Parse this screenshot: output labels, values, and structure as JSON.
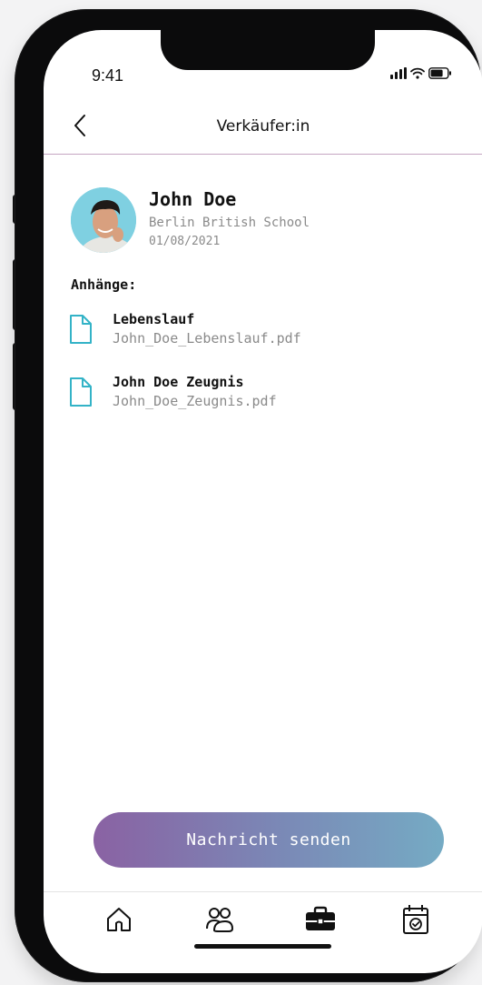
{
  "status_bar": {
    "time": "9:41"
  },
  "header": {
    "title": "Verkäufer:in",
    "back_icon": "chevron-left-icon"
  },
  "profile": {
    "name": "John Doe",
    "school": "Berlin British School",
    "date": "01/08/2021"
  },
  "attachments": {
    "heading": "Anhänge:",
    "items": [
      {
        "title": "Lebenslauf",
        "file": "John_Doe_Lebenslauf.pdf",
        "icon": "file-icon"
      },
      {
        "title": "John Doe Zeugnis",
        "file": "John_Doe_Zeugnis.pdf",
        "icon": "file-icon"
      }
    ]
  },
  "actions": {
    "send_label": "Nachricht senden"
  },
  "tabbar": {
    "items": [
      {
        "icon": "home-icon"
      },
      {
        "icon": "people-icon"
      },
      {
        "icon": "briefcase-icon",
        "active": true
      },
      {
        "icon": "calendar-check-icon"
      }
    ]
  },
  "colors": {
    "accent_gradient_start": "#8a62a3",
    "accent_gradient_end": "#75abc4",
    "file_icon": "#33b3c7",
    "divider": "#c6a6c2"
  }
}
